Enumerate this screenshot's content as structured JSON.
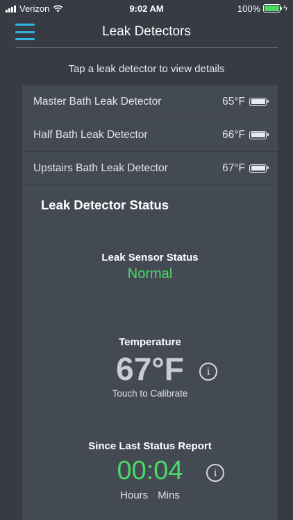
{
  "status_bar": {
    "carrier": "Verizon",
    "time": "9:02 AM",
    "battery_percent": "100%",
    "battery_level": 1.0
  },
  "nav": {
    "title": "Leak Detectors",
    "menu_icon": "hamburger-menu-icon"
  },
  "hint": "Tap a leak detector to view details",
  "detectors": [
    {
      "name": "Master Bath Leak Detector",
      "temp": "65°F",
      "battery_icon": "battery-icon"
    },
    {
      "name": "Half Bath Leak Detector",
      "temp": "66°F",
      "battery_icon": "battery-icon"
    },
    {
      "name": "Upstairs Bath Leak Detector",
      "temp": "67°F",
      "battery_icon": "battery-icon"
    }
  ],
  "status_panel": {
    "title": "Leak Detector Status",
    "sensor_label": "Leak Sensor Status",
    "sensor_value": "Normal",
    "temperature_label": "Temperature",
    "temperature_value": "67°F",
    "calibrate_text": "Touch to Calibrate",
    "since_label": "Since Last Status Report",
    "since_value": "00:04",
    "hours_label": "Hours",
    "mins_label": "Mins",
    "info_glyph": "i"
  },
  "colors": {
    "accent": "#33b5e5",
    "status_ok": "#4cd964",
    "background": "#363b44",
    "panel": "#444a54"
  }
}
